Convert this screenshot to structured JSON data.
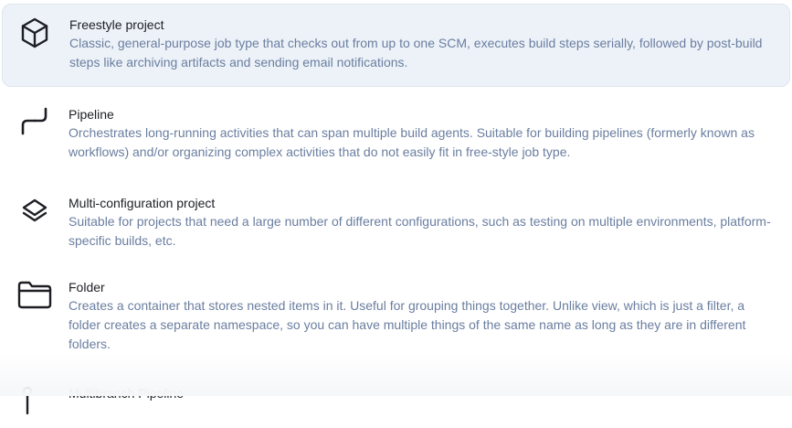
{
  "items": [
    {
      "icon": "cube-icon",
      "name": "Freestyle project",
      "description": "Classic, general-purpose job type that checks out from up to one SCM, executes build steps serially, followed by post-build steps like archiving artifacts and sending email notifications.",
      "selected": true
    },
    {
      "icon": "pipeline-icon",
      "name": "Pipeline",
      "description": "Orchestrates long-running activities that can span multiple build agents. Suitable for building pipelines (formerly known as workflows) and/or organizing complex activities that do not easily fit in free-style job type.",
      "selected": false
    },
    {
      "icon": "layers-icon",
      "name": "Multi-configuration project",
      "description": "Suitable for projects that need a large number of different configurations, such as testing on multiple environments, platform-specific builds, etc.",
      "selected": false
    },
    {
      "icon": "folder-icon",
      "name": "Folder",
      "description": "Creates a container that stores nested items in it. Useful for grouping things together. Unlike view, which is just a filter, a folder creates a separate namespace, so you can have multiple things of the same name as long as they are in different folders.",
      "selected": false
    },
    {
      "icon": "branch-icon",
      "name": "Multibranch Pipeline",
      "description": "",
      "selected": false
    }
  ],
  "colors": {
    "selected_background": "#edf2f8",
    "title_text": "#1d1f24",
    "description_text": "#6a7ea0"
  }
}
